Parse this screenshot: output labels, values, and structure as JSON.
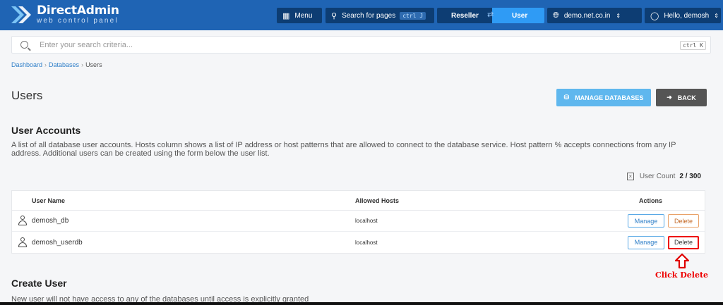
{
  "app": {
    "brand_title": "DirectAdmin",
    "brand_subtitle": "web control panel"
  },
  "topbar": {
    "menu_label": "Menu",
    "search_label": "Search for pages",
    "search_shortcut": "ctrl J",
    "reseller_label": "Reseller",
    "user_label": "User",
    "domain_label": "demo.net.co.in",
    "hello_label": "Hello, demosh"
  },
  "search": {
    "placeholder": "Enter your search criteria...",
    "shortcut": "ctrl K"
  },
  "breadcrumb": [
    "Dashboard",
    "Databases",
    "Users"
  ],
  "page": {
    "title": "Users",
    "manage_databases_label": "MANAGE DATABASES",
    "back_label": "BACK"
  },
  "accounts": {
    "title": "User Accounts",
    "description": "A list of all database user accounts. Hosts column shows a list of IP address or host patterns that are allowed to connect to the database service. Host pattern % accepts connections from any IP address. Additional users can be created using the form below the user list.",
    "count_label": "User Count",
    "count_value": "2 / 300"
  },
  "table": {
    "headers": [
      "User Name",
      "Allowed Hosts",
      "Actions"
    ],
    "rows": [
      {
        "user": "demosh_db",
        "hosts": "localhost"
      },
      {
        "user": "demosh_userdb",
        "hosts": "localhost"
      }
    ],
    "manage_label": "Manage",
    "delete_label": "Delete"
  },
  "annotation": {
    "note": "Click Delete",
    "color": "#e00000"
  },
  "create": {
    "title": "Create User",
    "subtitle": "New user will not have access to any of the databases until access is explicitly granted"
  },
  "colors": {
    "topbar": "#1f64b4",
    "accent": "#2f9bf5"
  }
}
